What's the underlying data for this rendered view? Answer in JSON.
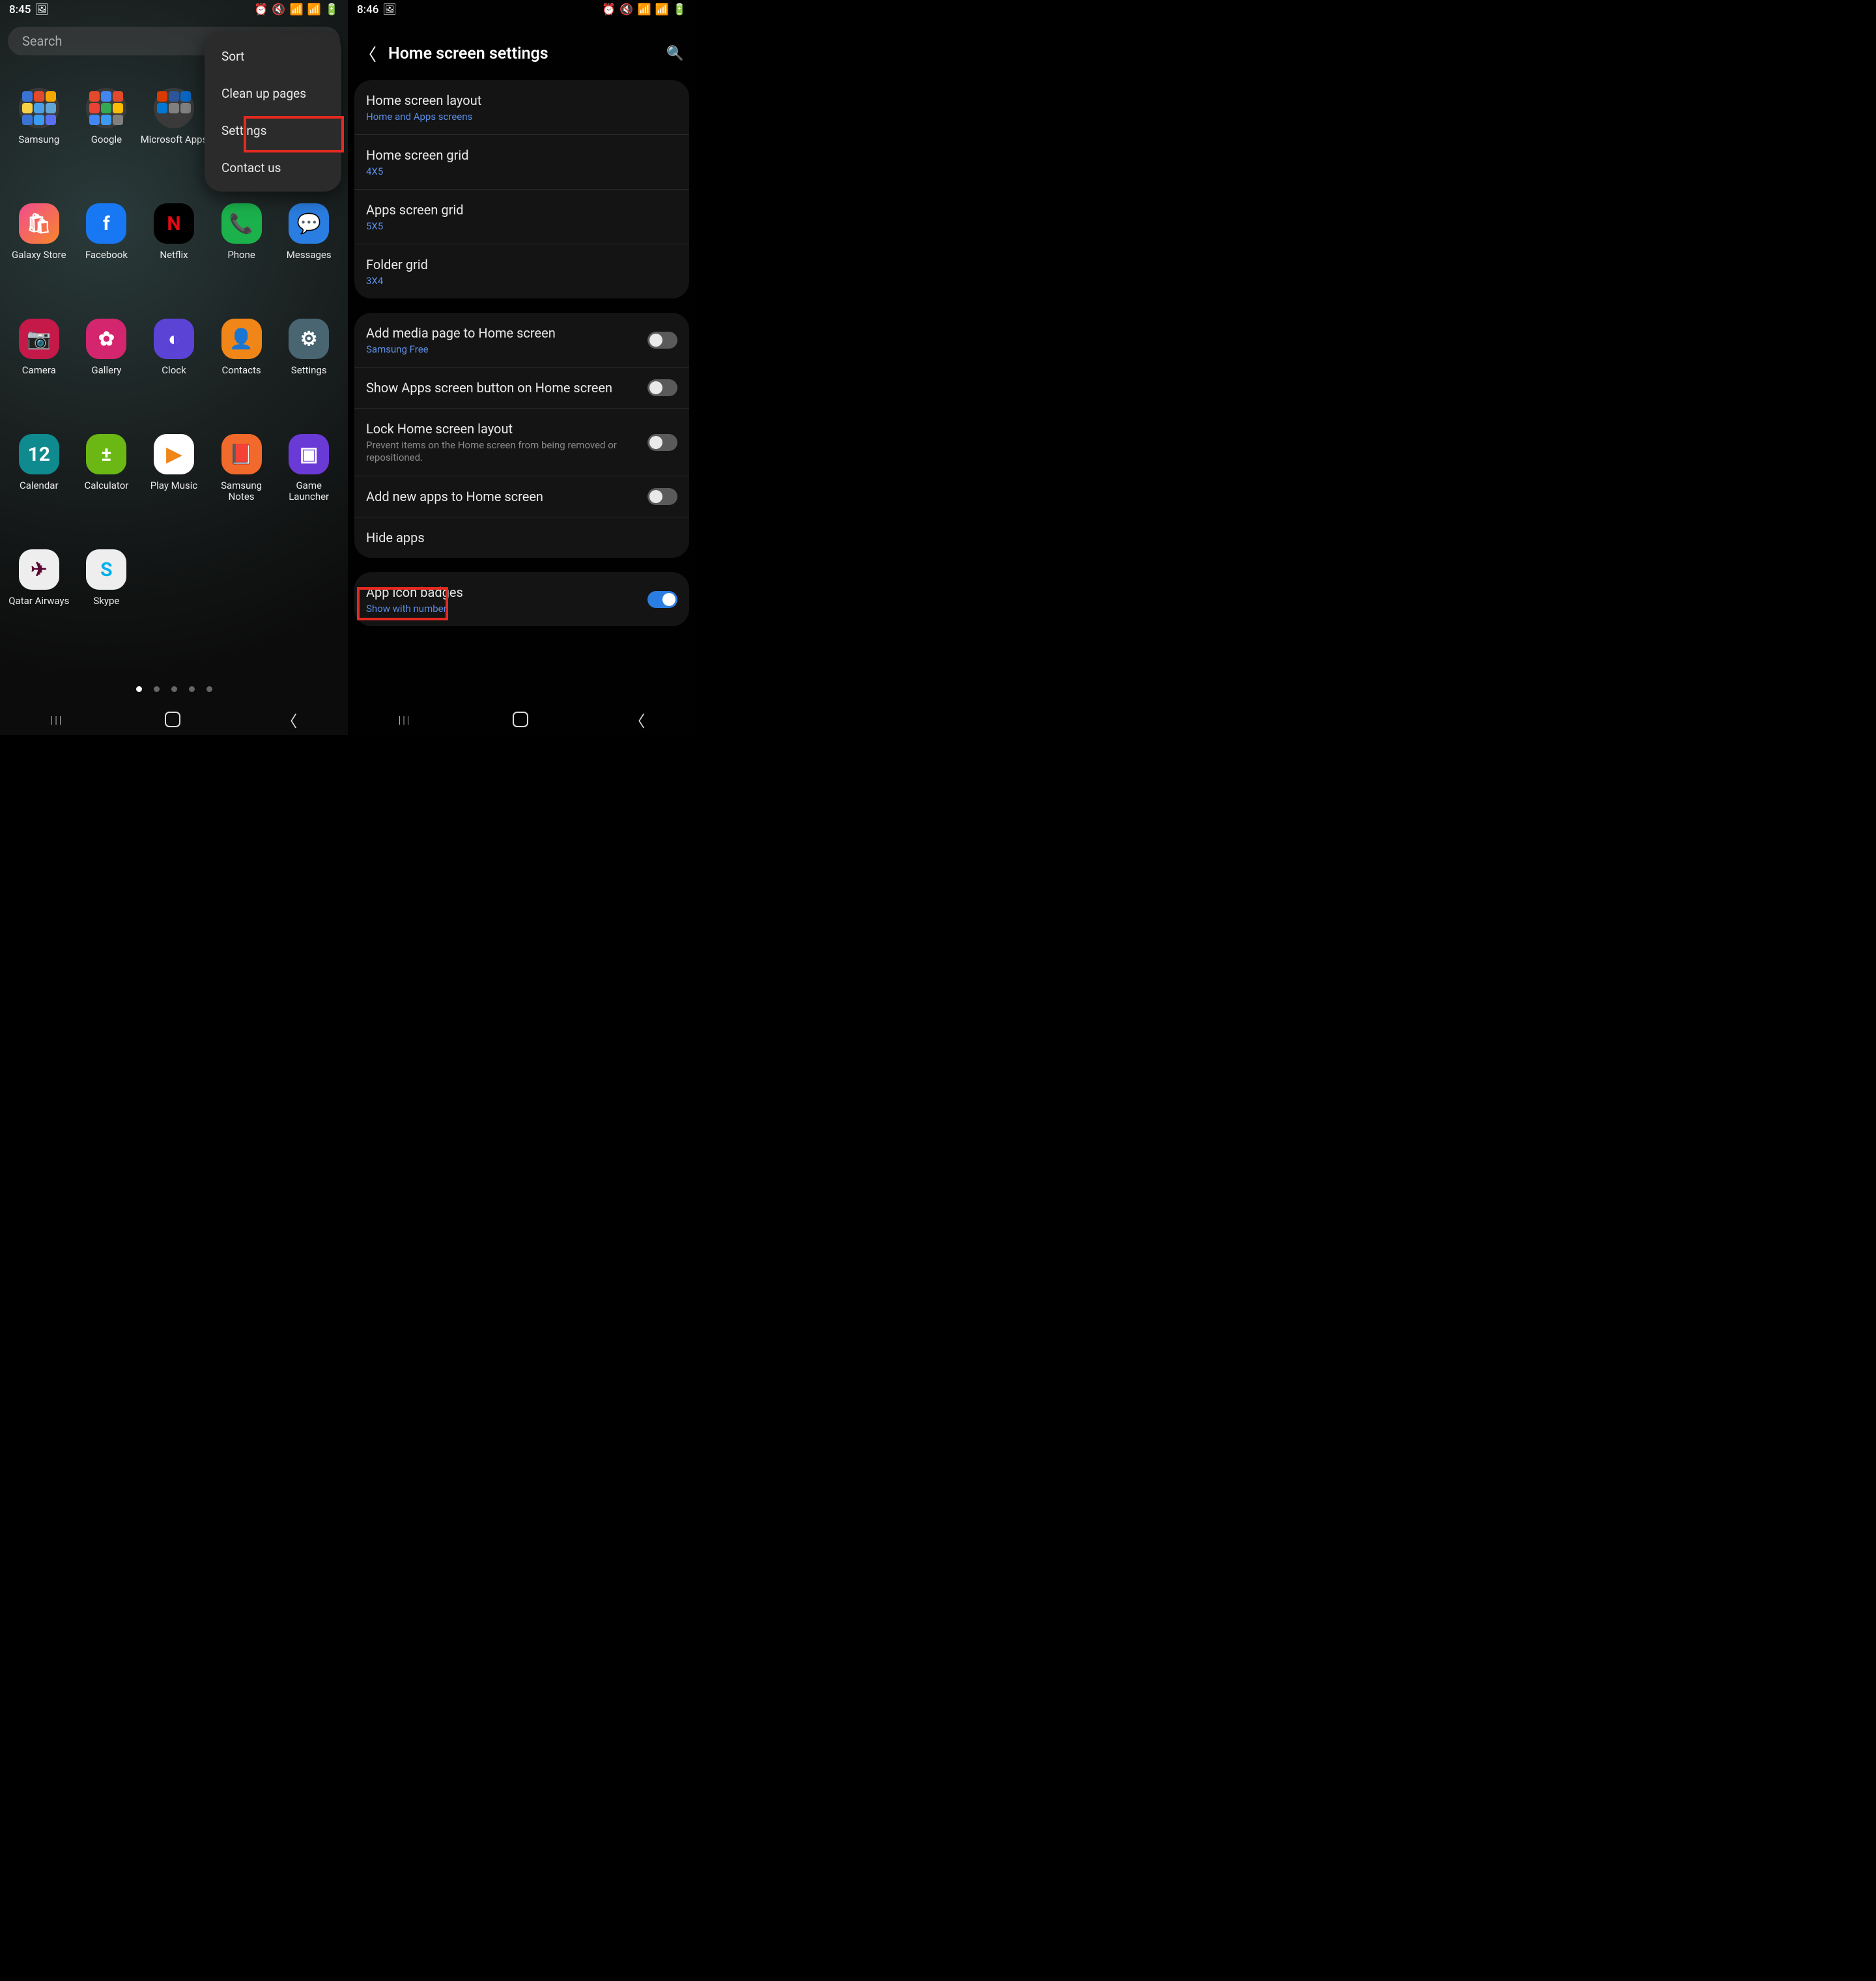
{
  "left": {
    "status_time": "8:45",
    "search_placeholder": "Search",
    "menu": {
      "sort": "Sort",
      "clean": "Clean up pages",
      "settings": "Settings",
      "contact": "Contact us"
    },
    "apps": [
      {
        "label": "Samsung",
        "color": "#3a3a3a",
        "glyph": "",
        "folder": true,
        "mini": [
          "#3a73d4",
          "#e34a2b",
          "#f6a600",
          "#f7d046",
          "#4aa0e8",
          "#62a6d9",
          "#3a73d4",
          "#3a9bf0",
          "#5a6ff0"
        ]
      },
      {
        "label": "Google",
        "color": "#3a3a3a",
        "glyph": "",
        "folder": true,
        "mini": [
          "#e34a2b",
          "#4286f4",
          "#e34a2b",
          "#ea4335",
          "#34a853",
          "#fbbc05",
          "#4286f4",
          "#3a9bf0",
          "#808080"
        ]
      },
      {
        "label": "Microsoft Apps",
        "color": "#3a3a3a",
        "glyph": "",
        "folder": true,
        "mini": [
          "#d83b01",
          "#2b579a",
          "#0a66c2",
          "#0078d4",
          "#808080",
          "#808080",
          "",
          "",
          ""
        ]
      },
      {
        "label": "",
        "color": "transparent",
        "glyph": ""
      },
      {
        "label": "",
        "color": "transparent",
        "glyph": ""
      },
      {
        "label": "Galaxy Store",
        "color": "linear-gradient(135deg,#f24b8e,#f6872b)",
        "glyph": "🛍"
      },
      {
        "label": "Facebook",
        "color": "#1877f2",
        "glyph": "f"
      },
      {
        "label": "Netflix",
        "color": "#000",
        "glyph": "N",
        "glyphColor": "#e50914"
      },
      {
        "label": "Phone",
        "color": "#1bb24c",
        "glyph": "📞"
      },
      {
        "label": "Messages",
        "color": "#2a7de1",
        "glyph": "💬"
      },
      {
        "label": "Camera",
        "color": "#c5194a",
        "glyph": "📷"
      },
      {
        "label": "Gallery",
        "color": "#d4256f",
        "glyph": "✿"
      },
      {
        "label": "Clock",
        "color": "#5b43d6",
        "glyph": "◐"
      },
      {
        "label": "Contacts",
        "color": "#f08518",
        "glyph": "👤"
      },
      {
        "label": "Settings",
        "color": "#4a6572",
        "glyph": "⚙"
      },
      {
        "label": "Calendar",
        "color": "#0f8a8f",
        "glyph": "12"
      },
      {
        "label": "Calculator",
        "color": "#6bb814",
        "glyph": "±"
      },
      {
        "label": "Play Music",
        "color": "#fff",
        "glyph": "▶",
        "glyphColor": "#f08518"
      },
      {
        "label": "Samsung Notes",
        "color": "#f26a2b",
        "glyph": "📕"
      },
      {
        "label": "Game Launcher",
        "color": "#6a3ad6",
        "glyph": "▣"
      },
      {
        "label": "Qatar Airways",
        "color": "#eee",
        "glyph": "✈",
        "glyphColor": "#5c0632"
      },
      {
        "label": "Skype",
        "color": "#eee",
        "glyph": "S",
        "glyphColor": "#00aff0"
      }
    ]
  },
  "right": {
    "status_time": "8:46",
    "title": "Home screen settings",
    "s1": [
      {
        "t": "Home screen layout",
        "s": "Home and Apps screens"
      },
      {
        "t": "Home screen grid",
        "s": "4X5"
      },
      {
        "t": "Apps screen grid",
        "s": "5X5"
      },
      {
        "t": "Folder grid",
        "s": "3X4"
      }
    ],
    "s2": [
      {
        "t": "Add media page to Home screen",
        "s": "Samsung Free",
        "tg": false,
        "sub": "blue"
      },
      {
        "t": "Show Apps screen button on Home screen",
        "tg": false
      },
      {
        "t": "Lock Home screen layout",
        "d": "Prevent items on the Home screen from being removed or repositioned.",
        "tg": false
      },
      {
        "t": "Add new apps to Home screen",
        "tg": false
      },
      {
        "t": "Hide apps"
      }
    ],
    "s3": [
      {
        "t": "App icon badges",
        "s": "Show with number",
        "tg": true,
        "sub": "blue"
      }
    ]
  }
}
